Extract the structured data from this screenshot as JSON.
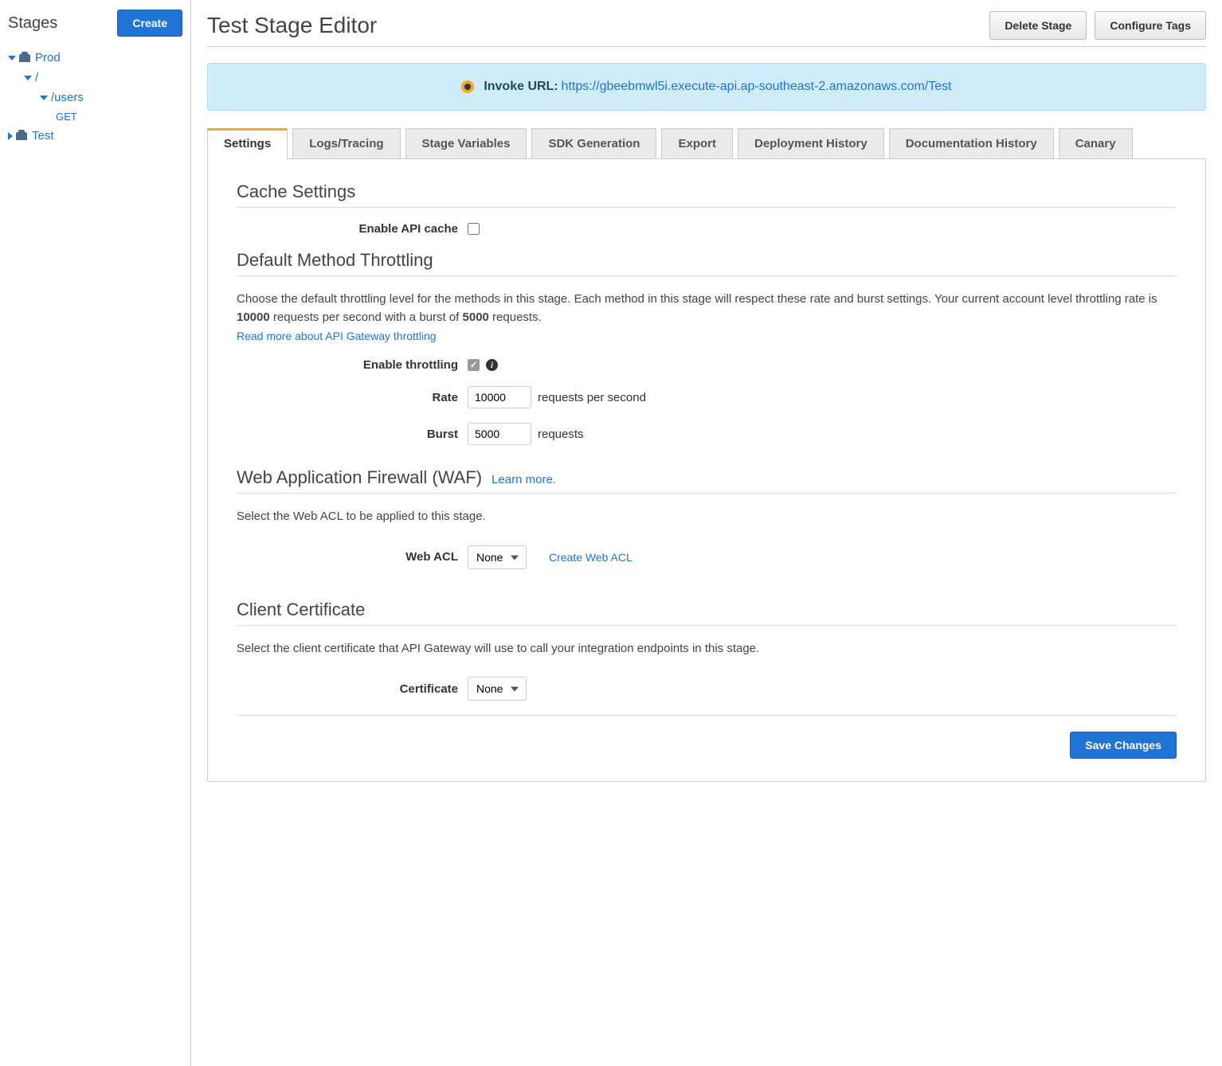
{
  "sidebar": {
    "title": "Stages",
    "create_button": "Create",
    "tree": {
      "items": [
        {
          "label": "Prod",
          "expanded": true,
          "icon": "stage"
        },
        {
          "label": "/",
          "expanded": true
        },
        {
          "label": "/users",
          "expanded": true
        },
        {
          "method": "GET"
        },
        {
          "label": "Test",
          "expanded": false,
          "icon": "stage"
        }
      ]
    }
  },
  "header": {
    "title": "Test Stage Editor",
    "delete_button": "Delete Stage",
    "configure_tags_button": "Configure Tags"
  },
  "invoke": {
    "label": "Invoke URL:",
    "url": "https://gbeebmwl5i.execute-api.ap-southeast-2.amazonaws.com/Test"
  },
  "tabs": [
    {
      "label": "Settings",
      "active": true
    },
    {
      "label": "Logs/Tracing"
    },
    {
      "label": "Stage Variables"
    },
    {
      "label": "SDK Generation"
    },
    {
      "label": "Export"
    },
    {
      "label": "Deployment History"
    },
    {
      "label": "Documentation History"
    },
    {
      "label": "Canary"
    }
  ],
  "cache": {
    "title": "Cache Settings",
    "enable_label": "Enable API cache",
    "enabled": false
  },
  "throttling": {
    "title": "Default Method Throttling",
    "desc_pre": "Choose the default throttling level for the methods in this stage. Each method in this stage will respect these rate and burst settings. Your current account level throttling rate is ",
    "rate_bold": "10000",
    "desc_mid": " requests per second with a burst of ",
    "burst_bold": "5000",
    "desc_post": " requests.",
    "read_more": "Read more about API Gateway throttling",
    "enable_label": "Enable throttling",
    "enabled": true,
    "rate_label": "Rate",
    "rate_value": "10000",
    "rate_suffix": "requests per second",
    "burst_label": "Burst",
    "burst_value": "5000",
    "burst_suffix": "requests"
  },
  "waf": {
    "title": "Web Application Firewall (WAF)",
    "learn_more": "Learn more.",
    "desc": "Select the Web ACL to be applied to this stage.",
    "web_acl_label": "Web ACL",
    "web_acl_value": "None",
    "create_link": "Create Web ACL"
  },
  "client_cert": {
    "title": "Client Certificate",
    "desc": "Select the client certificate that API Gateway will use to call your integration endpoints in this stage.",
    "label": "Certificate",
    "value": "None"
  },
  "footer": {
    "save_button": "Save Changes"
  }
}
